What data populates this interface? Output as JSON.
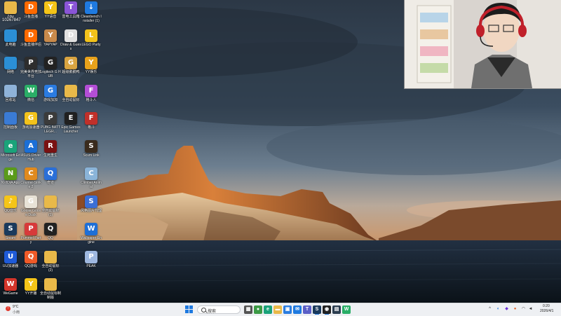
{
  "desktop": {
    "counter": "10267847",
    "icons": [
      {
        "label": "Zdw",
        "icon": "folder-icon",
        "color": "#e9b949",
        "glyph": ""
      },
      {
        "label": "此电脑",
        "icon": "monitor-icon",
        "color": "#2b8fd6",
        "glyph": ""
      },
      {
        "label": "网络",
        "icon": "network-icon",
        "color": "#2b8fd6",
        "glyph": ""
      },
      {
        "label": "回收站",
        "icon": "recycle-bin-icon",
        "color": "#8fb3d9",
        "glyph": ""
      },
      {
        "label": "控制面板",
        "icon": "control-panel-icon",
        "color": "#3a7bd5",
        "glyph": ""
      },
      {
        "label": "Microsoft Edge",
        "icon": "edge-icon",
        "color": "#1aa37a",
        "glyph": "e"
      },
      {
        "label": "NVIDIA App",
        "icon": "nvidia-icon",
        "color": "#5a9b1a",
        "glyph": "N"
      },
      {
        "label": "QQ音乐",
        "icon": "qq-music-icon",
        "color": "#f5c518",
        "glyph": "♪"
      },
      {
        "label": "Steam",
        "icon": "steam-icon",
        "color": "#1b3a5c",
        "glyph": "S"
      },
      {
        "label": "UU加速器",
        "icon": "uu-accelerator-icon",
        "color": "#1f5bd8",
        "glyph": "U"
      },
      {
        "label": "WeGame",
        "icon": "wegame-icon",
        "color": "#d4352b",
        "glyph": "W"
      },
      {
        "label": "斗鱼直播",
        "icon": "douyu-icon",
        "color": "#ff6a00",
        "glyph": "D"
      },
      {
        "label": "斗鱼直播伴侣",
        "icon": "douyu-companion-icon",
        "color": "#ff6a00",
        "glyph": "D"
      },
      {
        "label": "完美世界竞技平台",
        "icon": "perfect-world-icon",
        "color": "#2d2d2d",
        "glyph": "P"
      },
      {
        "label": "微信",
        "icon": "wechat-icon",
        "color": "#2aae67",
        "glyph": "W"
      },
      {
        "label": "游戏加速器",
        "icon": "game-booster-icon",
        "color": "#f2c21b",
        "glyph": "G"
      },
      {
        "label": "ASUS DriverHub",
        "icon": "asus-driverhub-icon",
        "color": "#1b6fd6",
        "glyph": "A"
      },
      {
        "label": "Counter-Strike 2",
        "icon": "cs2-icon",
        "color": "#e08a1e",
        "glyph": "C"
      },
      {
        "label": "Goose Goose Duck",
        "icon": "goose-goose-duck-icon",
        "color": "#e8e2d6",
        "glyph": "G"
      },
      {
        "label": "Pummel Party",
        "icon": "pummel-party-icon",
        "color": "#d73a3a",
        "glyph": "P"
      },
      {
        "label": "QQ游戏",
        "icon": "qq-game-icon",
        "color": "#f05a28",
        "glyph": "Q"
      },
      {
        "label": "YY开播",
        "icon": "yy-live-icon",
        "color": "#f5c518",
        "glyph": "Y"
      },
      {
        "label": "YY语音",
        "icon": "yy-voice-icon",
        "color": "#f5c518",
        "glyph": "Y"
      },
      {
        "label": "YAPYAP",
        "icon": "yapyap-icon",
        "color": "#c98a4b",
        "glyph": "Y"
      },
      {
        "label": "Logitech G HUB",
        "icon": "logitech-ghub-icon",
        "color": "#222222",
        "glyph": "G"
      },
      {
        "label": "游戏加加",
        "icon": "game-plus-icon",
        "color": "#2a7be0",
        "glyph": "G"
      },
      {
        "label": "PUBG BATTLEGR...",
        "icon": "pubg-icon",
        "color": "#3b3b3b",
        "glyph": "P"
      },
      {
        "label": "生死重生",
        "icon": "rebirth-icon",
        "color": "#7a1212",
        "glyph": "R"
      },
      {
        "label": "奇迹",
        "icon": "miracle-icon",
        "color": "#2a6fd8",
        "glyph": "Q"
      },
      {
        "label": "全自动鼠标(1)",
        "icon": "auto-mouse-icon",
        "color": "#e9b949",
        "glyph": ""
      },
      {
        "label": "QQ",
        "icon": "qq-icon",
        "color": "#222222",
        "glyph": "Q"
      },
      {
        "label": "全自动鼠标(2)",
        "icon": "auto-mouse-2-icon",
        "color": "#e9b949",
        "glyph": ""
      },
      {
        "label": "全自动鼠标制制版",
        "icon": "folder-icon",
        "color": "#e9b949",
        "glyph": ""
      },
      {
        "label": "雷电工具箱",
        "icon": "toolbox-icon",
        "color": "#8a55d6",
        "glyph": "T"
      },
      {
        "label": "Draw & Guess",
        "icon": "draw-guess-icon",
        "color": "#e0e0e0",
        "glyph": "D"
      },
      {
        "label": "超级鹅鹅鸭",
        "icon": "super-goose-icon",
        "color": "#d9a441",
        "glyph": "G"
      },
      {
        "label": "全自动鼠标",
        "icon": "folder-icon",
        "color": "#e9b949",
        "glyph": ""
      },
      {
        "label": "Epic Games Launcher",
        "icon": "epic-games-icon",
        "color": "#202020",
        "glyph": "E"
      },
      {
        "label": "Cleanbench Installer (1)",
        "icon": "installer-icon",
        "color": "#1f7ae0",
        "glyph": "↓"
      },
      {
        "label": "LEGO Party",
        "icon": "lego-party-icon",
        "color": "#f2c21b",
        "glyph": "L"
      },
      {
        "label": "YY娱乐",
        "icon": "yy-ent-icon",
        "color": "#e8a21b",
        "glyph": "Y"
      },
      {
        "label": "格斗人",
        "icon": "fighter-icon",
        "color": "#b34ed6",
        "glyph": "F"
      },
      {
        "label": "格斗",
        "icon": "fight-icon",
        "color": "#c0302a",
        "glyph": "F"
      },
      {
        "label": "Scum Link",
        "icon": "scum-link-icon",
        "color": "#3a2b1d",
        "glyph": "S"
      },
      {
        "label": "Climber Animal",
        "icon": "climber-animal-icon",
        "color": "#8ab4d9",
        "glyph": "C"
      },
      {
        "label": "风格图片代理",
        "icon": "style-proxy-icon",
        "color": "#3b6fd6",
        "glyph": "S"
      },
      {
        "label": "Wallpaper Engine",
        "icon": "wallpaper-engine-icon",
        "color": "#1e6fd6",
        "glyph": "W"
      },
      {
        "label": "PEAK",
        "icon": "peak-icon",
        "color": "#9fb8e0",
        "glyph": "P"
      }
    ]
  },
  "webcam": {
    "label": "webcam-overlay"
  },
  "taskbar": {
    "weather": {
      "temp": "9°C",
      "desc": "小雨"
    },
    "search_label": "搜索",
    "apps": [
      {
        "name": "task-view-icon",
        "color": "#555555",
        "glyph": "▦"
      },
      {
        "name": "chrome-icon",
        "color": "#3c9a46",
        "glyph": "●"
      },
      {
        "name": "edge-icon",
        "color": "#1aa37a",
        "glyph": "e"
      },
      {
        "name": "file-explorer-icon",
        "color": "#e9b949",
        "glyph": "▬"
      },
      {
        "name": "store-icon",
        "color": "#2b7de0",
        "glyph": "▣"
      },
      {
        "name": "mail-icon",
        "color": "#1f7ae0",
        "glyph": "✉"
      },
      {
        "name": "teams-icon",
        "color": "#5b5fc7",
        "glyph": "T"
      },
      {
        "name": "steam-icon",
        "color": "#1b3a5c",
        "glyph": "S"
      },
      {
        "name": "obs-icon",
        "color": "#222222",
        "glyph": "◉"
      },
      {
        "name": "app-icon",
        "color": "#2c3e50",
        "glyph": "▤"
      },
      {
        "name": "wechat-icon",
        "color": "#2aae67",
        "glyph": "W"
      }
    ],
    "clock": {
      "time": "0:20",
      "date": "2026/4/1"
    }
  }
}
